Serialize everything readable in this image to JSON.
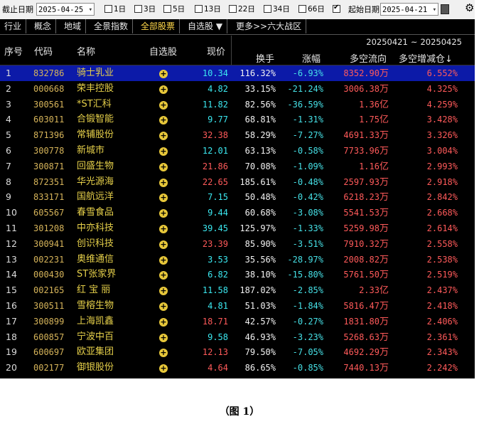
{
  "toolbar": {
    "end_date_label": "截止日期",
    "end_date": "2025-04-25",
    "periods": [
      {
        "label": "1日",
        "checked": false
      },
      {
        "label": "3日",
        "checked": false
      },
      {
        "label": "5日",
        "checked": false
      },
      {
        "label": "13日",
        "checked": false
      },
      {
        "label": "22日",
        "checked": false
      },
      {
        "label": "34日",
        "checked": false
      },
      {
        "label": "66日",
        "checked": false
      },
      {
        "label": "",
        "checked": true
      }
    ],
    "start_date_label": "起始日期",
    "start_date": "2025-04-21",
    "dropdown_glyph": "▾",
    "calc_icon": "calculator-icon",
    "gear_icon": "gear-icon",
    "gear_glyph": "⚙"
  },
  "tabs": [
    {
      "label": "行业"
    },
    {
      "label": "概念"
    },
    {
      "label": "地域"
    },
    {
      "label": "全景指数"
    },
    {
      "label": "全部股票",
      "active": true
    },
    {
      "label": "自选股 ▼"
    },
    {
      "label": "更多>>六大战区"
    }
  ],
  "header": {
    "range_start": "20250421",
    "range_sep": "~",
    "range_end": "20250425",
    "col_index": "序号",
    "col_code": "代码",
    "col_name": "名称",
    "col_fav": "自选股",
    "col_price": "现价",
    "col_turnover": "换手",
    "col_change": "涨幅",
    "col_flow": "多空流向",
    "col_increase": "多空增减仓↓"
  },
  "rows": [
    {
      "idx": "1",
      "code": "832786",
      "name": "骑士乳业",
      "price": "10.34",
      "turnover": "116.32%",
      "change": "-6.93%",
      "flow_num": "8352.90",
      "flow_unit": "万",
      "inc": "6.552%",
      "selected": true
    },
    {
      "idx": "2",
      "code": "000668",
      "name": "荣丰控股",
      "price": "4.82",
      "turnover": "33.15%",
      "change": "-21.24%",
      "flow_num": "3006.38",
      "flow_unit": "万",
      "inc": "4.325%"
    },
    {
      "idx": "3",
      "code": "300561",
      "name": "*ST汇科",
      "price": "11.82",
      "turnover": "82.56%",
      "change": "-36.59%",
      "flow_num": "1.36",
      "flow_unit": "亿",
      "inc": "4.259%"
    },
    {
      "idx": "4",
      "code": "603011",
      "name": "合锻智能",
      "price": "9.77",
      "turnover": "68.81%",
      "change": "-1.31%",
      "flow_num": "1.75",
      "flow_unit": "亿",
      "inc": "3.428%"
    },
    {
      "idx": "5",
      "code": "871396",
      "name": "常辅股份",
      "price": "32.38",
      "turnover": "58.29%",
      "change": "-7.27%",
      "flow_num": "4691.33",
      "flow_unit": "万",
      "inc": "3.326%",
      "price_up": true
    },
    {
      "idx": "6",
      "code": "300778",
      "name": "新城市",
      "price": "12.01",
      "turnover": "63.13%",
      "change": "-0.58%",
      "flow_num": "7733.96",
      "flow_unit": "万",
      "inc": "3.004%"
    },
    {
      "idx": "7",
      "code": "300871",
      "name": "回盛生物",
      "price": "21.86",
      "turnover": "70.08%",
      "change": "-1.09%",
      "flow_num": "1.16",
      "flow_unit": "亿",
      "inc": "2.993%",
      "price_up": true
    },
    {
      "idx": "8",
      "code": "872351",
      "name": "华光源海",
      "price": "22.65",
      "turnover": "185.61%",
      "change": "-0.48%",
      "flow_num": "2597.93",
      "flow_unit": "万",
      "inc": "2.918%",
      "price_up": true
    },
    {
      "idx": "9",
      "code": "833171",
      "name": "国航远洋",
      "price": "7.15",
      "turnover": "50.48%",
      "change": "-0.42%",
      "flow_num": "6218.23",
      "flow_unit": "万",
      "inc": "2.842%"
    },
    {
      "idx": "10",
      "code": "605567",
      "name": "春雪食品",
      "price": "9.44",
      "turnover": "60.68%",
      "change": "-3.08%",
      "flow_num": "5541.53",
      "flow_unit": "万",
      "inc": "2.668%"
    },
    {
      "idx": "11",
      "code": "301208",
      "name": "中亦科技",
      "price": "39.45",
      "turnover": "125.97%",
      "change": "-1.33%",
      "flow_num": "5259.98",
      "flow_unit": "万",
      "inc": "2.614%"
    },
    {
      "idx": "12",
      "code": "300941",
      "name": "创识科技",
      "price": "23.39",
      "turnover": "85.90%",
      "change": "-3.51%",
      "flow_num": "7910.32",
      "flow_unit": "万",
      "inc": "2.558%",
      "price_up": true
    },
    {
      "idx": "13",
      "code": "002231",
      "name": "奥维通信",
      "price": "3.53",
      "turnover": "35.56%",
      "change": "-28.97%",
      "flow_num": "2008.82",
      "flow_unit": "万",
      "inc": "2.538%"
    },
    {
      "idx": "14",
      "code": "000430",
      "name": "ST张家界",
      "price": "6.82",
      "turnover": "38.10%",
      "change": "-15.80%",
      "flow_num": "5761.50",
      "flow_unit": "万",
      "inc": "2.519%"
    },
    {
      "idx": "15",
      "code": "002165",
      "name": "红 宝 丽",
      "price": "11.58",
      "turnover": "187.02%",
      "change": "-2.85%",
      "flow_num": "2.33",
      "flow_unit": "亿",
      "inc": "2.437%"
    },
    {
      "idx": "16",
      "code": "300511",
      "name": "雪榕生物",
      "price": "4.81",
      "turnover": "51.03%",
      "change": "-1.84%",
      "flow_num": "5816.47",
      "flow_unit": "万",
      "inc": "2.418%"
    },
    {
      "idx": "17",
      "code": "300899",
      "name": "上海凯鑫",
      "price": "18.71",
      "turnover": "42.57%",
      "change": "-0.27%",
      "flow_num": "1831.80",
      "flow_unit": "万",
      "inc": "2.406%",
      "price_up": true
    },
    {
      "idx": "18",
      "code": "600857",
      "name": "宁波中百",
      "price": "9.58",
      "turnover": "46.93%",
      "change": "-3.23%",
      "flow_num": "5268.63",
      "flow_unit": "万",
      "inc": "2.361%"
    },
    {
      "idx": "19",
      "code": "600697",
      "name": "欧亚集团",
      "price": "12.13",
      "turnover": "79.50%",
      "change": "-7.05%",
      "flow_num": "4692.29",
      "flow_unit": "万",
      "inc": "2.343%",
      "price_up": true
    },
    {
      "idx": "20",
      "code": "002177",
      "name": "御银股份",
      "price": "4.64",
      "turnover": "86.65%",
      "change": "-0.85%",
      "flow_num": "7440.13",
      "flow_unit": "万",
      "inc": "2.242%",
      "price_up": true
    }
  ],
  "fav_icon": "add-favorite-icon",
  "fav_glyph": "+",
  "colors": {
    "background": "#000000",
    "selected_row": "#0c1aa8",
    "up_red": "#ff5a5a",
    "down_cyan": "#46e0e6",
    "price_cyan": "#3be8f0",
    "name_yellow": "#e6d04a",
    "code_gold": "#d6b45a"
  },
  "caption": "（图 1）"
}
